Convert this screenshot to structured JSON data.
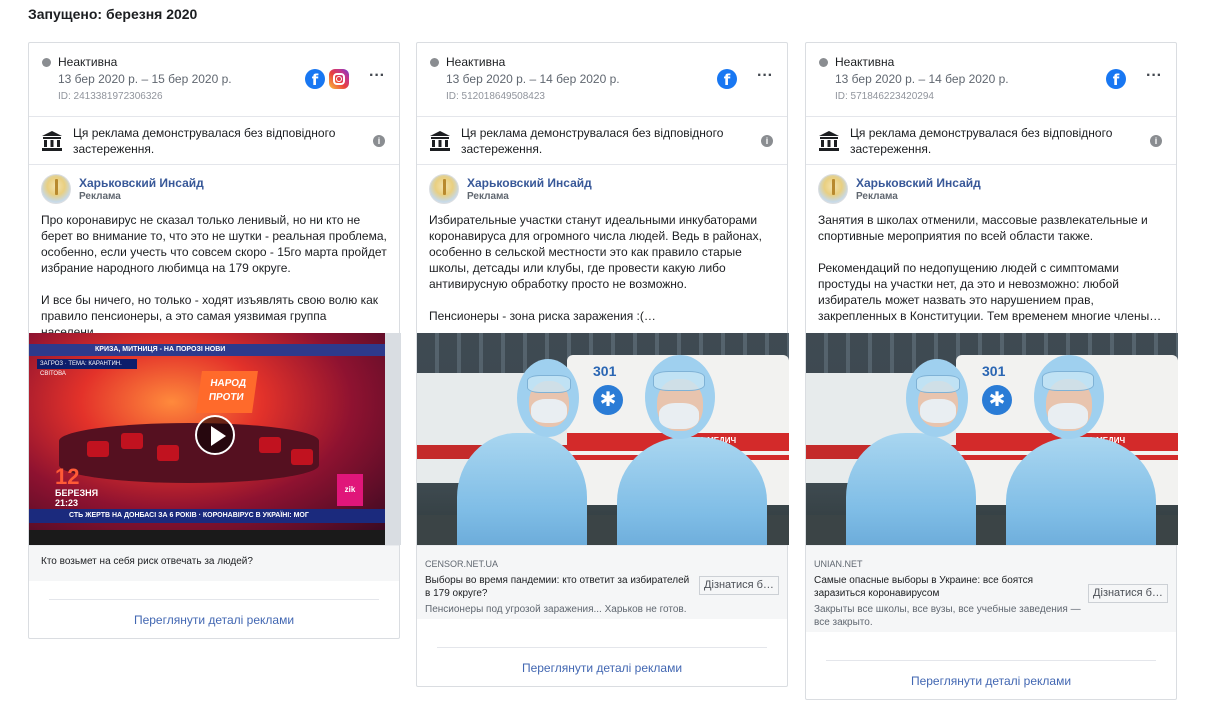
{
  "section": {
    "launched": "Запущено: березня 2020"
  },
  "cards": [
    {
      "status": "Неактивна",
      "dates": "13 бер 2020 р. – 15 бер 2020 р.",
      "id": "ID: 2413381972306326",
      "platforms": [
        "facebook-icon",
        "instagram-icon"
      ],
      "disclaimer": "Ця реклама демонструвалася без відповідного застереження.",
      "advertiser": "Харьковский Инсайд",
      "sponsored": "Реклама",
      "text": [
        "Про коронавирус не сказал только ленивый, но ни кто не берет во внимание то, что это не шутки - реальная проблема, особенно, если учесть что совсем скоро - 15го марта пройдет избрание народного любимца на 179 округе.",
        "И все бы ничего, но только - ходят изъявлять свою волю как правило пенсионеры, а это самая уязвимая группа населени…"
      ],
      "media": {
        "top_ticker": "КРИЗА, МИТНИЦЯ - НА ПОРОЗІ НОВИ",
        "small_ticker": "ЗАГРОЗ · ТЕМА: КАРАНТИН. СВІТОВА",
        "bottom_ticker": "СТЬ ЖЕРТВ НА ДОНБАСІ ЗА 6 РОКІВ · КОРОНАВІРУС В УКРАЇНІ: МОГ",
        "show_title": "НАРОД ПРОТИ",
        "day": "12",
        "month": "БЕРЕЗНЯ",
        "time": "21:23",
        "channel": "zik"
      },
      "caption": "Кто возьмет на себя риск отвечать за людей?",
      "details": "Переглянути деталі реклами"
    },
    {
      "status": "Неактивна",
      "dates": "13 бер 2020 р. – 14 бер 2020 р.",
      "id": "ID: 512018649508423",
      "platforms": [
        "facebook-icon"
      ],
      "disclaimer": "Ця реклама демонструвалася без відповідного застереження.",
      "advertiser": "Харьковский Инсайд",
      "sponsored": "Реклама",
      "text": [
        "Избирательные участки станут идеальными инкубаторами коронавируса для огромного числа людей. Ведь в районах, особенно в сельской местности это как правило старые школы, детсады или клубы, где провести какую либо антивирусную обработку просто не возможно.",
        "Пенсионеры - зона риска заражения :(…"
      ],
      "media": {
        "vehicle_number": "301",
        "vehicle_label": "ВИДКА МЕДИЧ"
      },
      "link": {
        "domain": "CENSOR.NET.UA",
        "title": "Выборы во время пандемии: кто ответит за избирателей в 179 округе?",
        "description": "Пенсионеры под угрозой заражения... Харьков не готов.",
        "button": "Дізнатися б…"
      },
      "details": "Переглянути деталі реклами"
    },
    {
      "status": "Неактивна",
      "dates": "13 бер 2020 р. – 14 бер 2020 р.",
      "id": "ID: 571846223420294",
      "platforms": [
        "facebook-icon"
      ],
      "disclaimer": "Ця реклама демонструвалася без відповідного застереження.",
      "advertiser": "Харьковский Инсайд",
      "sponsored": "Реклама",
      "text": [
        "Занятия в школах отменили, массовые развлекательные и спортивные мероприятия по всей области также.",
        "Рекомендаций по недопущению людей с симптомами простуды на участки нет, да это и невозможно: любой избиратель может назвать это нарушением прав, закрепленных в Конституции. Тем временем многие члены…"
      ],
      "media": {
        "vehicle_number": "301",
        "vehicle_label": "ВИДКА МЕДИЧ"
      },
      "link": {
        "domain": "UNIAN.NET",
        "title": "Самые опасные выборы в Украине: все боятся заразиться коронавирусом",
        "description": "Закрыты все школы, все вузы, все учебные заведения — все закрыто.",
        "button": "Дізнатися б…"
      },
      "details": "Переглянути деталі реклами"
    }
  ]
}
